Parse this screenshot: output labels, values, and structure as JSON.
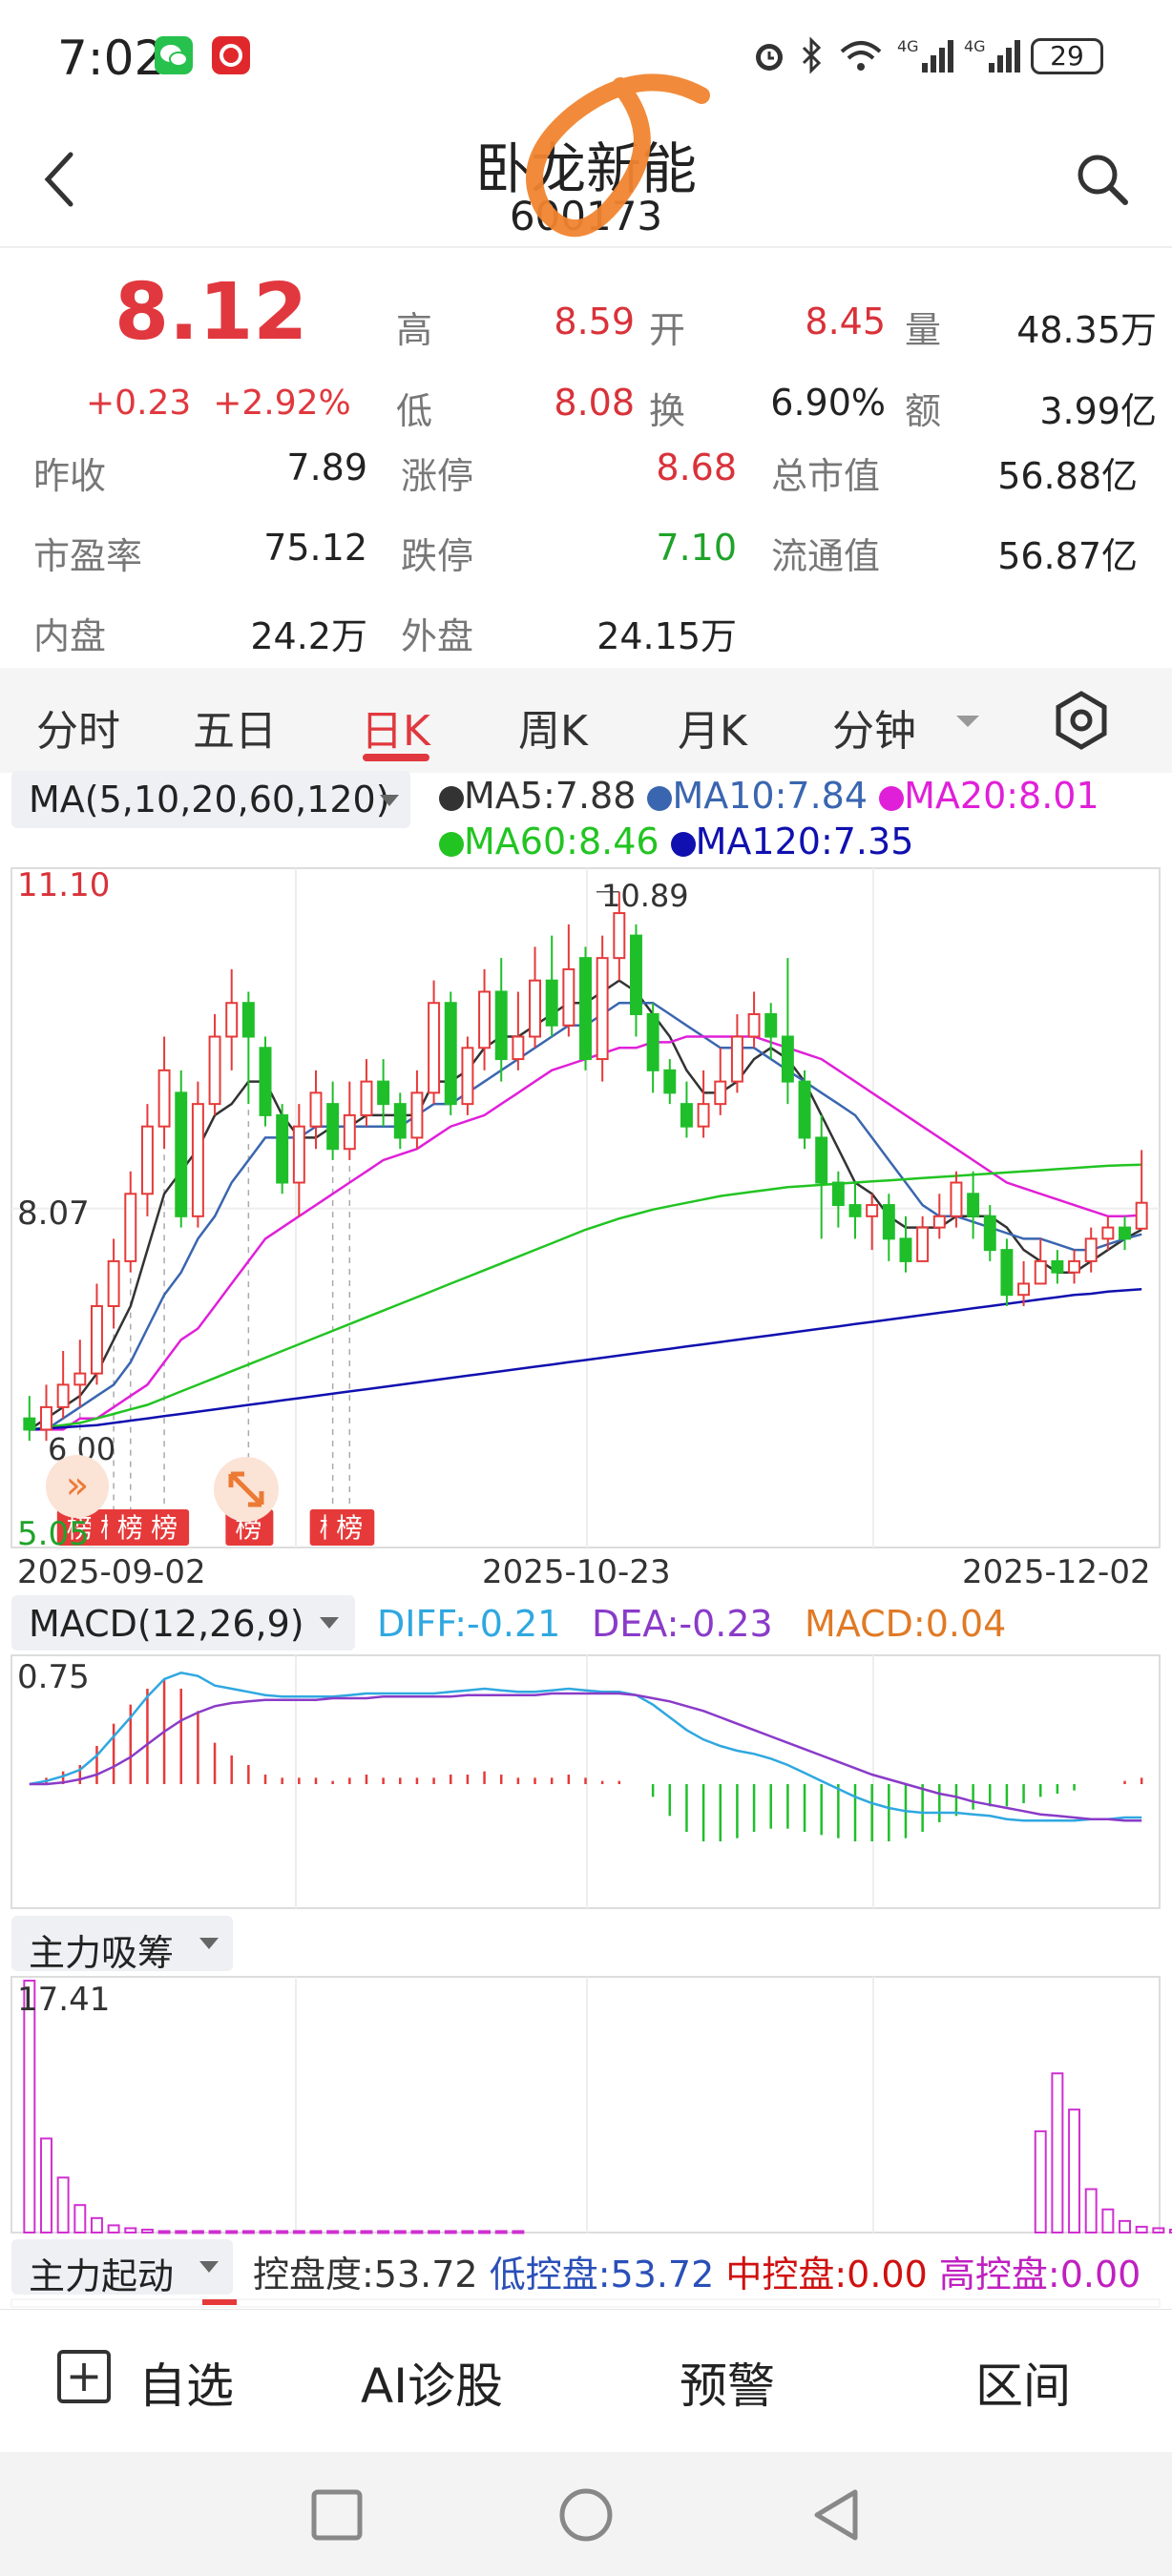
{
  "status_bar": {
    "time": "7:02",
    "network": "4G",
    "battery": "29",
    "icons": [
      "wechat-icon",
      "app-icon",
      "alarm-icon",
      "bluetooth-icon",
      "wifi-icon",
      "signal-icon",
      "battery-icon"
    ]
  },
  "header": {
    "stock_name": "卧龙新能",
    "stock_code": "600173",
    "back_icon": "back-arrow-icon",
    "search_icon": "search-icon"
  },
  "quote": {
    "price": "8.12",
    "change": "+0.23",
    "change_pct": "+2.92%",
    "fields": [
      {
        "label": "高",
        "value": "8.59"
      },
      {
        "label": "开",
        "value": "8.45"
      },
      {
        "label": "量",
        "value": "48.35万"
      },
      {
        "label": "低",
        "value": "8.08"
      },
      {
        "label": "换",
        "value": "6.90%"
      },
      {
        "label": "额",
        "value": "3.99亿"
      },
      {
        "label": "昨收",
        "value": "7.89"
      },
      {
        "label": "涨停",
        "value": "8.68"
      },
      {
        "label": "总市值",
        "value": "56.88亿"
      },
      {
        "label": "市盈率",
        "value": "75.12"
      },
      {
        "label": "跌停",
        "value": "7.10"
      },
      {
        "label": "流通值",
        "value": "56.87亿"
      },
      {
        "label": "内盘",
        "value": "24.2万"
      },
      {
        "label": "外盘",
        "value": "24.15万"
      }
    ]
  },
  "tabs": [
    "分时",
    "五日",
    "日K",
    "周K",
    "月K",
    "分钟"
  ],
  "active_tab": "日K",
  "ma_panel": {
    "selector": "MA(5,10,20,60,120)",
    "legend": [
      {
        "label": "MA5:7.88",
        "color": "#333333"
      },
      {
        "label": "MA10:7.84",
        "color": "#3a66b0"
      },
      {
        "label": "MA20:8.01",
        "color": "#e020d8"
      },
      {
        "label": "MA60:8.46",
        "color": "#22c422"
      },
      {
        "label": "MA120:7.35",
        "color": "#1010b0"
      }
    ],
    "axis_top": "11.10",
    "axis_mid": "8.07",
    "axis_bottom": "5.05",
    "high_marker": "10.89",
    "low_marker": "6.00",
    "dates": [
      "2025-09-02",
      "2025-10-23",
      "2025-12-02"
    ],
    "list_tag": "榜"
  },
  "macd_panel": {
    "selector": "MACD(12,26,9)",
    "diff": "DIFF:-0.21",
    "dea": "DEA:-0.23",
    "macd": "MACD:0.04",
    "axis_top": "0.75"
  },
  "chip_panel": {
    "selector": "主力吸筹",
    "axis_top": "17.41"
  },
  "start_panel": {
    "selector": "主力起动",
    "items": [
      {
        "label": "控盘度:53.72",
        "color": "#333333"
      },
      {
        "label": "低控盘:53.72",
        "color": "#2a4fb8"
      },
      {
        "label": "中控盘:0.00",
        "color": "#d01010"
      },
      {
        "label": "高控盘:0.00",
        "color": "#c020c0"
      }
    ]
  },
  "bottom_bar": {
    "watchlist": "自选",
    "ai": "AI诊股",
    "alert": "预警",
    "range": "区间"
  },
  "chart_data": {
    "type": "candlestick",
    "title": "",
    "dates_shown": [
      "2025-09-02",
      "2025-10-23",
      "2025-12-02"
    ],
    "ylim": [
      5.05,
      11.1
    ],
    "candles": [
      [
        6.2,
        6.1,
        6.4,
        6.0
      ],
      [
        6.1,
        6.3,
        6.5,
        6.0
      ],
      [
        6.3,
        6.5,
        6.8,
        6.2
      ],
      [
        6.5,
        6.6,
        6.9,
        6.3
      ],
      [
        6.6,
        7.2,
        7.4,
        6.5
      ],
      [
        7.2,
        7.6,
        7.8,
        7.0
      ],
      [
        7.6,
        8.2,
        8.4,
        7.5
      ],
      [
        8.2,
        8.8,
        9.0,
        8.0
      ],
      [
        8.8,
        9.3,
        9.6,
        8.6
      ],
      [
        9.1,
        8.0,
        9.3,
        7.9
      ],
      [
        8.0,
        9.0,
        9.2,
        7.9
      ],
      [
        9.0,
        9.6,
        9.8,
        8.9
      ],
      [
        9.6,
        9.9,
        10.2,
        9.3
      ],
      [
        9.9,
        9.6,
        10.0,
        9.0
      ],
      [
        9.5,
        8.9,
        9.6,
        8.8
      ],
      [
        8.9,
        8.3,
        9.0,
        8.2
      ],
      [
        8.3,
        8.8,
        9.0,
        8.0
      ],
      [
        8.8,
        9.1,
        9.3,
        8.6
      ],
      [
        9.0,
        8.6,
        9.2,
        8.5
      ],
      [
        8.6,
        8.9,
        9.2,
        8.5
      ],
      [
        8.9,
        9.2,
        9.4,
        8.8
      ],
      [
        9.2,
        9.0,
        9.4,
        8.8
      ],
      [
        9.0,
        8.7,
        9.1,
        8.6
      ],
      [
        8.7,
        9.1,
        9.3,
        8.6
      ],
      [
        9.1,
        9.9,
        10.1,
        9.0
      ],
      [
        9.9,
        9.0,
        10.0,
        8.9
      ],
      [
        9.0,
        9.5,
        9.6,
        8.9
      ],
      [
        9.5,
        10.0,
        10.2,
        9.3
      ],
      [
        10.0,
        9.4,
        10.3,
        9.2
      ],
      [
        9.4,
        9.6,
        10.0,
        9.3
      ],
      [
        9.6,
        10.1,
        10.4,
        9.5
      ],
      [
        10.1,
        9.7,
        10.5,
        9.6
      ],
      [
        9.7,
        10.2,
        10.6,
        9.6
      ],
      [
        10.3,
        9.4,
        10.4,
        9.3
      ],
      [
        9.4,
        10.3,
        10.5,
        9.2
      ],
      [
        10.3,
        10.7,
        10.89,
        10.1
      ],
      [
        10.5,
        9.8,
        10.6,
        9.6
      ],
      [
        9.8,
        9.3,
        9.9,
        9.1
      ],
      [
        9.3,
        9.1,
        9.4,
        9.0
      ],
      [
        9.0,
        8.8,
        9.2,
        8.7
      ],
      [
        8.8,
        9.0,
        9.3,
        8.7
      ],
      [
        9.0,
        9.2,
        9.5,
        8.9
      ],
      [
        9.2,
        9.6,
        9.8,
        9.1
      ],
      [
        9.6,
        9.8,
        10.0,
        9.5
      ],
      [
        9.8,
        9.6,
        9.9,
        9.4
      ],
      [
        9.6,
        9.2,
        10.3,
        9.0
      ],
      [
        9.2,
        8.7,
        9.3,
        8.6
      ],
      [
        8.7,
        8.3,
        8.9,
        7.8
      ],
      [
        8.3,
        8.1,
        8.4,
        7.9
      ],
      [
        8.1,
        8.0,
        8.3,
        7.8
      ],
      [
        8.0,
        8.1,
        8.2,
        7.7
      ],
      [
        8.1,
        7.8,
        8.2,
        7.6
      ],
      [
        7.8,
        7.6,
        8.0,
        7.5
      ],
      [
        7.6,
        7.9,
        8.0,
        7.6
      ],
      [
        7.9,
        8.0,
        8.2,
        7.8
      ],
      [
        8.0,
        8.3,
        8.4,
        7.9
      ],
      [
        8.2,
        8.0,
        8.4,
        7.8
      ],
      [
        8.0,
        7.7,
        8.1,
        7.6
      ],
      [
        7.7,
        7.3,
        7.8,
        7.2
      ],
      [
        7.3,
        7.4,
        7.6,
        7.2
      ],
      [
        7.4,
        7.6,
        7.8,
        7.4
      ],
      [
        7.6,
        7.5,
        7.7,
        7.4
      ],
      [
        7.5,
        7.6,
        7.7,
        7.4
      ],
      [
        7.6,
        7.8,
        7.9,
        7.5
      ],
      [
        7.8,
        7.9,
        8.0,
        7.7
      ],
      [
        7.9,
        7.8,
        8.0,
        7.7
      ],
      [
        7.89,
        8.12,
        8.59,
        8.08
      ]
    ],
    "ma": {
      "MA5": [
        6.1,
        6.2,
        6.3,
        6.4,
        6.6,
        6.9,
        7.2,
        7.7,
        8.2,
        8.4,
        8.6,
        8.9,
        9.0,
        9.2,
        9.2,
        8.9,
        8.7,
        8.7,
        8.8,
        8.8,
        8.9,
        8.9,
        8.9,
        8.9,
        9.2,
        9.2,
        9.3,
        9.5,
        9.6,
        9.6,
        9.7,
        9.8,
        9.9,
        9.9,
        10.0,
        10.1,
        10.0,
        9.8,
        9.6,
        9.3,
        9.1,
        9.1,
        9.2,
        9.4,
        9.5,
        9.4,
        9.2,
        8.9,
        8.6,
        8.3,
        8.2,
        8.0,
        7.9,
        7.9,
        7.9,
        8.0,
        8.0,
        8.0,
        7.9,
        7.7,
        7.6,
        7.5,
        7.5,
        7.6,
        7.7,
        7.8,
        7.88
      ],
      "MA10": [
        6.1,
        6.1,
        6.2,
        6.3,
        6.4,
        6.5,
        6.7,
        7.0,
        7.3,
        7.5,
        7.8,
        8.0,
        8.3,
        8.5,
        8.7,
        8.7,
        8.7,
        8.8,
        8.8,
        8.8,
        8.8,
        8.8,
        8.8,
        8.9,
        9.0,
        9.0,
        9.1,
        9.2,
        9.3,
        9.4,
        9.5,
        9.6,
        9.7,
        9.7,
        9.8,
        9.9,
        9.9,
        9.9,
        9.8,
        9.7,
        9.6,
        9.5,
        9.5,
        9.5,
        9.4,
        9.3,
        9.2,
        9.1,
        9.0,
        8.9,
        8.7,
        8.5,
        8.3,
        8.1,
        8.0,
        8.0,
        7.95,
        7.9,
        7.85,
        7.8,
        7.8,
        7.75,
        7.7,
        7.7,
        7.75,
        7.8,
        7.84
      ],
      "MA20": [
        6.1,
        6.1,
        6.1,
        6.2,
        6.2,
        6.3,
        6.4,
        6.5,
        6.7,
        6.9,
        7.0,
        7.2,
        7.4,
        7.6,
        7.8,
        7.9,
        8.0,
        8.1,
        8.2,
        8.3,
        8.4,
        8.5,
        8.55,
        8.6,
        8.7,
        8.8,
        8.85,
        8.9,
        9.0,
        9.1,
        9.2,
        9.3,
        9.35,
        9.4,
        9.45,
        9.5,
        9.5,
        9.55,
        9.55,
        9.6,
        9.6,
        9.6,
        9.6,
        9.6,
        9.55,
        9.5,
        9.45,
        9.4,
        9.3,
        9.2,
        9.1,
        9.0,
        8.9,
        8.8,
        8.7,
        8.6,
        8.5,
        8.4,
        8.3,
        8.25,
        8.2,
        8.15,
        8.1,
        8.05,
        8.0,
        8.0,
        8.01
      ],
      "MA60": [
        6.1,
        6.12,
        6.14,
        6.16,
        6.2,
        6.24,
        6.28,
        6.32,
        6.38,
        6.44,
        6.5,
        6.56,
        6.62,
        6.68,
        6.74,
        6.8,
        6.86,
        6.92,
        6.98,
        7.04,
        7.1,
        7.16,
        7.22,
        7.28,
        7.34,
        7.4,
        7.46,
        7.52,
        7.58,
        7.64,
        7.7,
        7.76,
        7.82,
        7.88,
        7.93,
        7.98,
        8.02,
        8.06,
        8.09,
        8.12,
        8.15,
        8.18,
        8.2,
        8.22,
        8.24,
        8.26,
        8.27,
        8.28,
        8.29,
        8.3,
        8.31,
        8.32,
        8.33,
        8.34,
        8.35,
        8.36,
        8.37,
        8.38,
        8.39,
        8.4,
        8.41,
        8.42,
        8.43,
        8.44,
        8.45,
        8.455,
        8.46
      ],
      "MA120": [
        6.1,
        6.11,
        6.12,
        6.13,
        6.14,
        6.16,
        6.18,
        6.2,
        6.22,
        6.24,
        6.26,
        6.28,
        6.3,
        6.32,
        6.34,
        6.36,
        6.38,
        6.4,
        6.42,
        6.44,
        6.46,
        6.48,
        6.5,
        6.52,
        6.54,
        6.56,
        6.58,
        6.6,
        6.62,
        6.64,
        6.66,
        6.68,
        6.7,
        6.72,
        6.74,
        6.76,
        6.78,
        6.8,
        6.82,
        6.84,
        6.86,
        6.88,
        6.9,
        6.92,
        6.94,
        6.96,
        6.98,
        7.0,
        7.02,
        7.04,
        7.06,
        7.08,
        7.1,
        7.12,
        7.14,
        7.16,
        7.18,
        7.2,
        7.22,
        7.24,
        7.26,
        7.28,
        7.3,
        7.31,
        7.33,
        7.34,
        7.35
      ]
    },
    "macd": {
      "diff": [
        0.0,
        0.02,
        0.05,
        0.09,
        0.18,
        0.3,
        0.42,
        0.55,
        0.66,
        0.7,
        0.68,
        0.62,
        0.6,
        0.58,
        0.56,
        0.55,
        0.55,
        0.55,
        0.55,
        0.56,
        0.57,
        0.57,
        0.57,
        0.57,
        0.57,
        0.58,
        0.59,
        0.6,
        0.59,
        0.58,
        0.58,
        0.59,
        0.6,
        0.59,
        0.58,
        0.58,
        0.56,
        0.5,
        0.42,
        0.34,
        0.28,
        0.24,
        0.21,
        0.19,
        0.16,
        0.12,
        0.07,
        0.02,
        -0.03,
        -0.08,
        -0.12,
        -0.15,
        -0.17,
        -0.18,
        -0.18,
        -0.18,
        -0.19,
        -0.2,
        -0.22,
        -0.23,
        -0.23,
        -0.23,
        -0.23,
        -0.22,
        -0.22,
        -0.21,
        -0.21
      ],
      "dea": [
        0.0,
        0.0,
        0.01,
        0.03,
        0.06,
        0.11,
        0.17,
        0.25,
        0.33,
        0.4,
        0.45,
        0.49,
        0.51,
        0.52,
        0.53,
        0.53,
        0.53,
        0.53,
        0.54,
        0.54,
        0.54,
        0.55,
        0.55,
        0.55,
        0.55,
        0.55,
        0.56,
        0.56,
        0.56,
        0.56,
        0.56,
        0.57,
        0.57,
        0.57,
        0.57,
        0.57,
        0.56,
        0.54,
        0.52,
        0.49,
        0.46,
        0.42,
        0.38,
        0.34,
        0.3,
        0.26,
        0.22,
        0.18,
        0.14,
        0.1,
        0.06,
        0.03,
        0.0,
        -0.03,
        -0.06,
        -0.08,
        -0.11,
        -0.13,
        -0.15,
        -0.17,
        -0.19,
        -0.2,
        -0.21,
        -0.22,
        -0.22,
        -0.23,
        -0.23
      ],
      "hist": [
        0.0,
        0.04,
        0.08,
        0.12,
        0.24,
        0.38,
        0.5,
        0.6,
        0.66,
        0.6,
        0.46,
        0.26,
        0.18,
        0.12,
        0.06,
        0.04,
        0.04,
        0.04,
        0.02,
        0.04,
        0.06,
        0.04,
        0.04,
        0.04,
        0.04,
        0.06,
        0.06,
        0.08,
        0.06,
        0.04,
        0.04,
        0.04,
        0.06,
        0.04,
        0.02,
        0.02,
        0.0,
        -0.08,
        -0.2,
        -0.3,
        -0.36,
        -0.36,
        -0.34,
        -0.3,
        -0.28,
        -0.28,
        -0.3,
        -0.32,
        -0.34,
        -0.36,
        -0.36,
        -0.36,
        -0.34,
        -0.3,
        -0.24,
        -0.2,
        -0.16,
        -0.14,
        -0.14,
        -0.12,
        -0.08,
        -0.06,
        -0.04,
        0.0,
        0.0,
        0.02,
        0.04
      ]
    },
    "chip": [
      17.41,
      6.5,
      3.8,
      1.9,
      1.0,
      0.5,
      0.3,
      0.2,
      0.1,
      0.1,
      0.1,
      0.1,
      0.1,
      0.1,
      0.1,
      0.1,
      0.1,
      0.1,
      0.1,
      0.1,
      0.1,
      0.1,
      0.1,
      0.1,
      0.1,
      0.1,
      0.1,
      0.1,
      0.1,
      0.1,
      0,
      0,
      0,
      0,
      0,
      0,
      0,
      0,
      0,
      0,
      0,
      0,
      0,
      0,
      0,
      0,
      0,
      0,
      0,
      0,
      0,
      0,
      0,
      0,
      0,
      0,
      0,
      0,
      0,
      0,
      7.0,
      11.0,
      8.5,
      3.0,
      1.6,
      0.8,
      0.4,
      0.3,
      0.2
    ],
    "list_markers_at": [
      3,
      5,
      6,
      8,
      13,
      18,
      19
    ]
  }
}
